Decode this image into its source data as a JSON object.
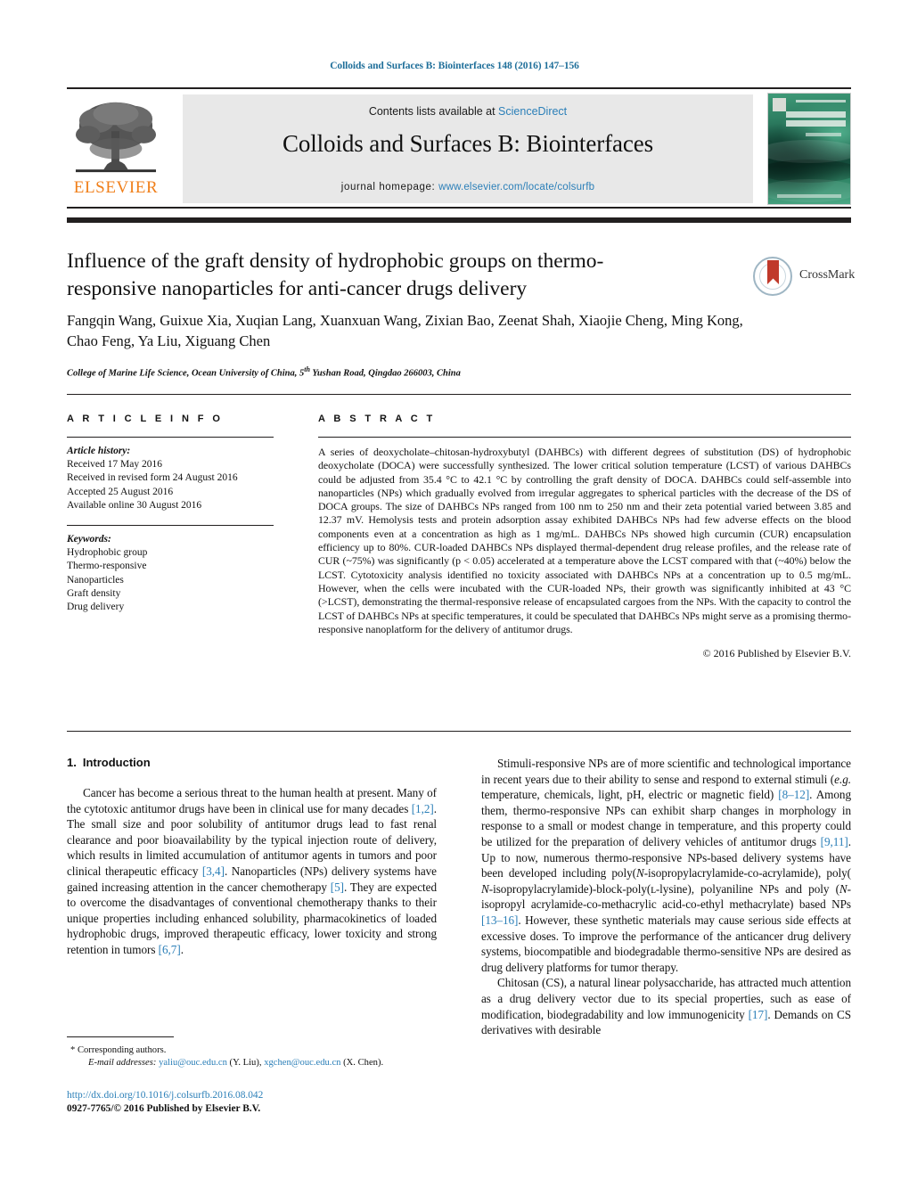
{
  "running_head": "Colloids and Surfaces B: Biointerfaces 148 (2016) 147–156",
  "masthead": {
    "publisher_name": "ELSEVIER",
    "contents_prefix": "Contents lists available at ",
    "contents_link": "ScienceDirect",
    "journal_title": "Colloids and Surfaces B: Biointerfaces",
    "homepage_label": "journal homepage:",
    "homepage_url": "www.elsevier.com/locate/colsurfb",
    "cover_caption": "COLLOIDS AND SURFACES B"
  },
  "article": {
    "title": "Influence of the graft density of hydrophobic groups on thermo-responsive nanoparticles for anti-cancer drugs delivery",
    "authors": "Fangqin Wang, Guixue Xia, Xuqian Lang, Xuanxuan Wang, Zixian Bao, Zeenat Shah, Xiaojie Cheng, Ming Kong, Chao Feng, Ya Liu, Xiguang Chen",
    "affiliation_pre": "College of Marine Life Science, Ocean University of China, 5",
    "affiliation_sup": "th",
    "affiliation_post": " Yushan Road, Qingdao 266003, China",
    "crossmark_label": "CrossMark"
  },
  "article_info": {
    "heading": "A R T I C L E   I N F O",
    "history_label": "Article history:",
    "history": [
      "Received 17 May 2016",
      "Received in revised form 24 August 2016",
      "Accepted 25 August 2016",
      "Available online 30 August 2016"
    ],
    "keywords_label": "Keywords:",
    "keywords": [
      "Hydrophobic group",
      "Thermo-responsive",
      "Nanoparticles",
      "Graft density",
      "Drug delivery"
    ]
  },
  "abstract": {
    "heading": "A B S T R A C T",
    "text": "A series of deoxycholate–chitosan-hydroxybutyl (DAHBCs) with different degrees of substitution (DS) of hydrophobic deoxycholate (DOCA) were successfully synthesized. The lower critical solution temperature (LCST) of various DAHBCs could be adjusted from 35.4 °C to 42.1 °C by controlling the graft density of DOCA. DAHBCs could self-assemble into nanoparticles (NPs) which gradually evolved from irregular aggregates to spherical particles with the decrease of the DS of DOCA groups. The size of DAHBCs NPs ranged from 100 nm to 250 nm and their zeta potential varied between 3.85 and 12.37 mV. Hemolysis tests and protein adsorption assay exhibited DAHBCs NPs had few adverse effects on the blood components even at a concentration as high as 1 mg/mL. DAHBCs NPs showed high curcumin (CUR) encapsulation efficiency up to 80%. CUR-loaded DAHBCs NPs displayed thermal-dependent drug release profiles, and the release rate of CUR (~75%) was significantly (p < 0.05) accelerated at a temperature above the LCST compared with that (~40%) below the LCST. Cytotoxicity analysis identified no toxicity associated with DAHBCs NPs at a concentration up to 0.5 mg/mL. However, when the cells were incubated with the CUR-loaded NPs, their growth was significantly inhibited at 43 °C (>LCST), demonstrating the thermal-responsive release of encapsulated cargoes from the NPs. With the capacity to control the LCST of DAHBCs NPs at specific temperatures, it could be speculated that DAHBCs NPs might serve as a promising thermo-responsive nanoplatform for the delivery of antitumor drugs.",
    "copyright": "© 2016 Published by Elsevier B.V."
  },
  "introduction": {
    "number": "1.",
    "title": "Introduction",
    "paragraphs": [
      {
        "segments": [
          {
            "t": "Cancer has become a serious threat to the human health at present. Many of the cytotoxic antitumor drugs have been in clinical use for many decades "
          },
          {
            "t": "[1,2]",
            "k": "ref"
          },
          {
            "t": ". The small size and poor solubility of antitumor drugs lead to fast renal clearance and poor bioavailability by the typical injection route of delivery, which results in limited accumulation of antitumor agents in tumors and poor clinical therapeutic efficacy "
          },
          {
            "t": "[3,4]",
            "k": "ref"
          },
          {
            "t": ". Nanoparticles (NPs) delivery systems have gained increasing attention in the cancer chemotherapy "
          },
          {
            "t": "[5]",
            "k": "ref"
          },
          {
            "t": ". They are expected to overcome the disadvantages of conventional chemotherapy thanks to their unique properties including enhanced solubility, pharmacokinetics of loaded hydrophobic drugs, improved therapeutic efficacy, lower toxicity and strong retention in tumors "
          },
          {
            "t": "[6,7]",
            "k": "ref"
          },
          {
            "t": "."
          }
        ]
      },
      {
        "segments": [
          {
            "t": "Stimuli-responsive NPs are of more scientific and technological importance in recent years due to their ability to sense and respond to external stimuli ("
          },
          {
            "t": "e.g.",
            "k": "i"
          },
          {
            "t": " temperature, chemicals, light, pH, electric or magnetic field) "
          },
          {
            "t": "[8–12]",
            "k": "ref"
          },
          {
            "t": ". Among them, thermo-responsive NPs can exhibit sharp changes in morphology in response to a small or modest change in temperature, and this property could be utilized for the preparation of delivery vehicles of antitumor drugs "
          },
          {
            "t": "[9,11]",
            "k": "ref"
          },
          {
            "t": ". Up to now, numerous thermo-responsive NPs-based delivery systems have been developed including poly("
          },
          {
            "t": "N",
            "k": "i"
          },
          {
            "t": "-isopropylacrylamide-co-acrylamide), poly( "
          },
          {
            "t": "N",
            "k": "i"
          },
          {
            "t": "-isopropylacrylamide)-block-poly(ʟ-lysine), polyaniline NPs and poly ("
          },
          {
            "t": "N",
            "k": "i"
          },
          {
            "t": "-isopropyl acrylamide-co-methacrylic acid-co-ethyl methacrylate) based NPs "
          },
          {
            "t": "[13–16]",
            "k": "ref"
          },
          {
            "t": ". However, these synthetic materials may cause serious side effects at excessive doses. To improve the performance of the anticancer drug delivery systems, biocompatible and biodegradable thermo-sensitive NPs are desired as drug delivery platforms for tumor therapy."
          }
        ]
      },
      {
        "segments": [
          {
            "t": "Chitosan (CS), a natural linear polysaccharide, has attracted much attention as a drug delivery vector due to its special properties, such as ease of modification, biodegradability and low immunogenicity "
          },
          {
            "t": "[17]",
            "k": "ref"
          },
          {
            "t": ". Demands on CS derivatives with desirable"
          }
        ]
      }
    ]
  },
  "footnotes": {
    "corresponding": "* Corresponding authors.",
    "email_label": "E-mail addresses:",
    "email1": "yaliu@ouc.edu.cn",
    "email1_owner": " (Y. Liu),",
    "email2": "xgchen@ouc.edu.cn",
    "email2_owner": " (X. Chen)."
  },
  "footer": {
    "doi": "http://dx.doi.org/10.1016/j.colsurfb.2016.08.042",
    "issn_line": "0927-7765/© 2016 Published by Elsevier B.V."
  },
  "colors": {
    "link": "#2b7fb8",
    "elsevier_orange": "#f07f1a",
    "rule": "#221f1f",
    "band": "#e8e8e8"
  }
}
